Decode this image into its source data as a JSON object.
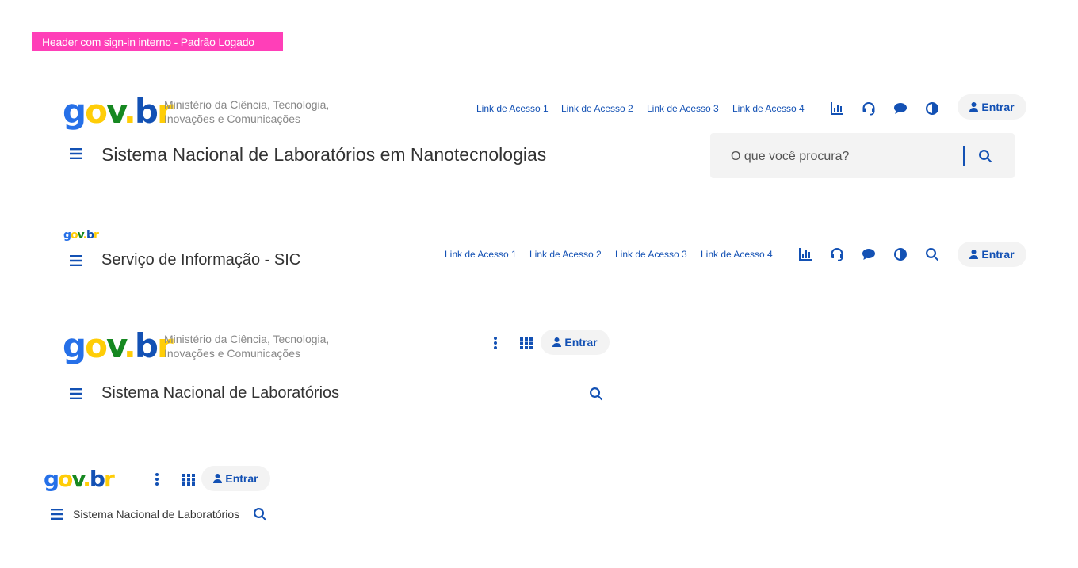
{
  "banner": {
    "label": "Header com sign-in interno - Padrão Logado"
  },
  "logo": {
    "g": "g",
    "o": "o",
    "v": "v",
    "dot": ".",
    "b": "b",
    "r": "r"
  },
  "ministry": {
    "line1": "Ministério da Ciência, Tecnologia,",
    "line2": "Inovações e Comunicações"
  },
  "quick_links": [
    "Link de Acesso 1",
    "Link de Acesso 2",
    "Link de Acesso 3",
    "Link de Acesso 4"
  ],
  "login": {
    "label": "Entrar"
  },
  "header1": {
    "title": "Sistema Nacional de Laboratórios em Nanotecnologias",
    "search_placeholder": "O que você procura?"
  },
  "header2": {
    "title": "Serviço de Informação - SIC"
  },
  "header3": {
    "title": "Sistema Nacional de Laboratórios"
  },
  "header4": {
    "title": "Sistema Nacional de Laboratórios"
  },
  "colors": {
    "primary": "#1351b4",
    "banner": "#ff3fb8",
    "logo_blue": "#2670e8",
    "logo_yellow": "#ffcd07",
    "logo_green": "#168821"
  },
  "icons": [
    "chart-bar-icon",
    "headset-icon",
    "comment-icon",
    "contrast-icon",
    "search-icon",
    "bars-icon",
    "ellipsis-vertical-icon",
    "grid-icon",
    "user-icon"
  ]
}
